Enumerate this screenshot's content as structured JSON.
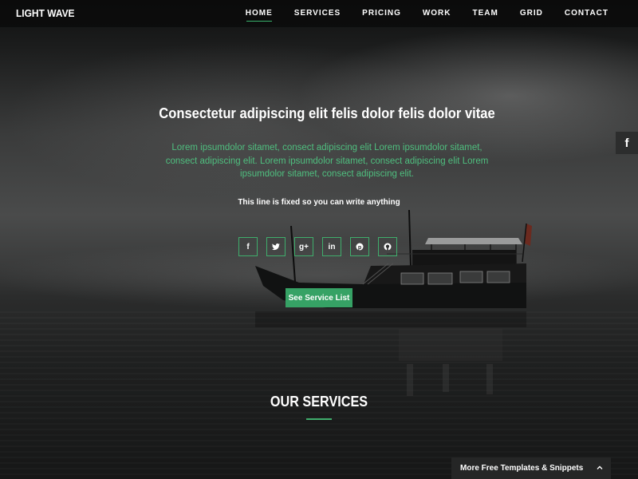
{
  "brand": "LIGHT WAVE",
  "nav": {
    "items": [
      "HOME",
      "SERVICES",
      "PRICING",
      "WORK",
      "TEAM",
      "GRID",
      "CONTACT"
    ],
    "active": "HOME"
  },
  "hero": {
    "headline": "Consectetur adipiscing elit felis dolor felis dolor vitae",
    "lead": "Lorem ipsumdolor sitamet, consect adipiscing elit Lorem ipsumdolor sitamet, consect adipiscing elit. Lorem ipsumdolor sitamet, consect adipiscing elit Lorem ipsumdolor sitamet, consect adipiscing elit.",
    "fixed_line": "This line is fixed so you can write anything",
    "social": [
      {
        "icon": "facebook-icon",
        "glyph": "f"
      },
      {
        "icon": "twitter-icon",
        "glyph": "t"
      },
      {
        "icon": "google-plus-icon",
        "glyph": "g+"
      },
      {
        "icon": "linkedin-icon",
        "glyph": "in"
      },
      {
        "icon": "pinterest-icon",
        "glyph": "p"
      },
      {
        "icon": "github-icon",
        "glyph": "gh"
      }
    ],
    "cta_label": "See Service List"
  },
  "services": {
    "title": "OUR SERVICES"
  },
  "side_tab": {
    "icon": "facebook-icon",
    "glyph": "f"
  },
  "bottom_tab": {
    "label": "More Free Templates & Snippets",
    "icon": "chevron-up-icon"
  },
  "colors": {
    "accent": "#36a265",
    "lead_text": "#4fbf7f",
    "navbar": "#0a0a0a"
  }
}
